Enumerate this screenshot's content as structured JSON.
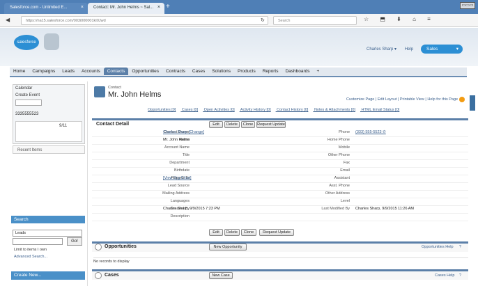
{
  "browser": {
    "tabs": [
      {
        "label": "Salesforce.com - Unlimited E...",
        "close": "×"
      },
      {
        "label": "Contact: Mr. John Helms ~ Sal...",
        "close": "×"
      }
    ],
    "new_tab": "+",
    "window_control": "▭▭▭",
    "url": "https://na15.salesforce.com/003i000001kI0Jwd",
    "search_placeholder": "Search",
    "nav_back": "◀",
    "nav_refresh": "↻",
    "toolbar_icons": "☆ ⬒ ⬇ ⌂ ≡"
  },
  "sf_header": {
    "logo_text": "salesforce",
    "user_menu": "Charles Sharp ▾",
    "help": "Help",
    "app_menu": "Sales",
    "app_menu_chevron": "▾"
  },
  "tabs": [
    "Home",
    "Campaigns",
    "Leads",
    "Accounts",
    "Contacts",
    "Opportunities",
    "Contracts",
    "Cases",
    "Solutions",
    "Products",
    "Reports",
    "Dashboards",
    "+"
  ],
  "active_tab": 4,
  "sidebar": {
    "calendar_label": "Calendar",
    "create_new": "Create Event",
    "number": "3335555523",
    "date": "9/11",
    "recent_items": "Recent Items",
    "search_header": "Search",
    "search_scope": "Leads",
    "go_label": "Go!",
    "limit_label": "Limit to items I own",
    "advanced_search": "Advanced Search...",
    "create_new_header": "Create New..."
  },
  "record": {
    "object_label": "Contact",
    "name": "Mr. John Helms",
    "top_links": "Customize Page | Edit Layout | Printable View | Help for this Page",
    "related_links": [
      "Opportunities [0]",
      "Cases [0]",
      "Open Activities [0]",
      "Activity History [0]",
      "Contact History [0]",
      "Notes & Attachments [0]",
      "HTML Email Status [0]"
    ],
    "section_title": "Contact Detail",
    "buttons": [
      "Edit",
      "Delete",
      "Clone",
      "Request Update"
    ],
    "fields_left": [
      {
        "label": "Contact Owner",
        "value": "Charles Sharp [Change]",
        "link": true
      },
      {
        "label": "Name",
        "value": "Mr. John Helms",
        "link": false
      },
      {
        "label": "Account Name",
        "value": "",
        "link": false
      },
      {
        "label": "Title",
        "value": "",
        "link": false
      },
      {
        "label": "Department",
        "value": "",
        "link": false
      },
      {
        "label": "Birthdate",
        "value": "",
        "link": false
      },
      {
        "label": "Reports To",
        "value": "[View Org Chart]",
        "link": true
      },
      {
        "label": "Lead Source",
        "value": "",
        "link": false
      },
      {
        "label": "Mailing Address",
        "value": "",
        "link": false
      },
      {
        "label": "Languages",
        "value": "",
        "link": false
      },
      {
        "label": "Created By",
        "value": "Charles Sharp, 9/9/2015 7:23 PM",
        "link": false
      },
      {
        "label": "Description",
        "value": "",
        "link": false
      }
    ],
    "fields_right": [
      {
        "label": "Phone",
        "value": "(333) 555-5523 ✆",
        "link": true
      },
      {
        "label": "Home Phone",
        "value": "",
        "link": false
      },
      {
        "label": "Mobile",
        "value": "",
        "link": false
      },
      {
        "label": "Other Phone",
        "value": "",
        "link": false
      },
      {
        "label": "Fax",
        "value": "",
        "link": false
      },
      {
        "label": "Email",
        "value": "",
        "link": false
      },
      {
        "label": "Assistant",
        "value": "",
        "link": false
      },
      {
        "label": "Asst. Phone",
        "value": "",
        "link": false
      },
      {
        "label": "Other Address",
        "value": "",
        "link": false
      },
      {
        "label": "Level",
        "value": "",
        "link": false
      },
      {
        "label": "Last Modified By",
        "value": "Charles Sharp, 9/9/2015 11:26 AM",
        "link": false
      }
    ],
    "opportunities": {
      "title": "Opportunities",
      "button": "New Opportunity",
      "help": "Opportunities Help",
      "help_icon": "?",
      "empty": "No records to display"
    },
    "cases": {
      "title": "Cases",
      "button": "New Case",
      "help": "Cases Help",
      "help_icon": "?"
    }
  }
}
